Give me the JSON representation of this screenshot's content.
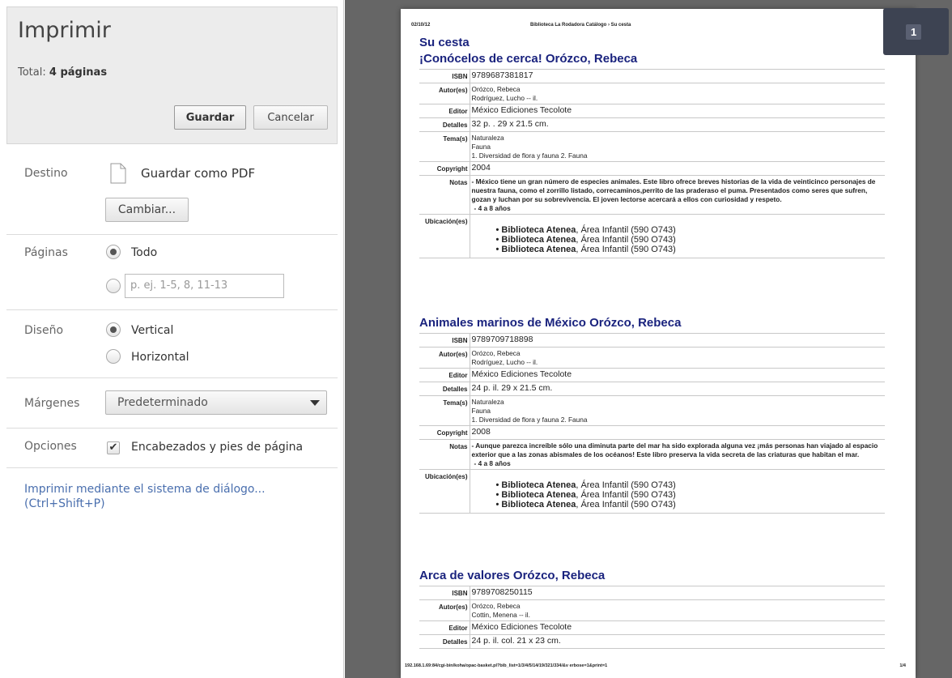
{
  "sidebar": {
    "title": "Imprimir",
    "total_label": "Total:",
    "total_value": "4 páginas",
    "save_label": "Guardar",
    "cancel_label": "Cancelar",
    "destination": {
      "label": "Destino",
      "value": "Guardar como PDF",
      "change_label": "Cambiar..."
    },
    "pages": {
      "label": "Páginas",
      "all_label": "Todo",
      "range_placeholder": "p. ej. 1-5, 8, 11-13"
    },
    "layout": {
      "label": "Diseño",
      "portrait_label": "Vertical",
      "landscape_label": "Horizontal"
    },
    "margins": {
      "label": "Márgenes",
      "value": "Predeterminado"
    },
    "options": {
      "label": "Opciones",
      "headers_label": "Encabezados y pies de página"
    },
    "system_dialog_link": "Imprimir mediante el sistema de diálogo...",
    "system_dialog_shortcut": "(Ctrl+Shift+P)"
  },
  "preview": {
    "page_indicator": "1",
    "header_date": "02/10/12",
    "header_title": "Biblioteca La Rodadora Catálogo › Su cesta",
    "heading": "Su cesta",
    "footer_url": "192.168.1.69:84/cgi-bin/koha/opac-basket.pl?bib_list=1/3/4/5/14/19/321/334/&v erbose=1&print=1",
    "footer_page": "1/4",
    "books": [
      {
        "title": "¡Conócelos de cerca! Orózco, Rebeca",
        "isbn_k": "ISBN",
        "isbn": "9789687381817",
        "autor_k": "Autor(es)",
        "autor1": "Orózco, Rebeca",
        "autor2": "Rodríguez, Lucho -- il.",
        "editor_k": "Editor",
        "editor": "México Ediciones Tecolote",
        "detalles_k": "Detalles",
        "detalles": "32 p. . 29 x 21.5 cm.",
        "tema_k": "Tema(s)",
        "tema1": "Naturaleza",
        "tema2": "Fauna",
        "tema3": "1. Diversidad de flora y fauna 2. Fauna",
        "copyright_k": "Copyright",
        "copyright": "2004",
        "notas_k": "Notas",
        "notas": "- México tiene un gran número de especies animales. Este libro ofrece breves historias de la vida de veinticinco personajes de nuestra fauna, como el zorrillo listado, correcaminos,perrito de las praderaso el puma. Presentados como seres que sufren, gozan y luchan por su sobrevivencia. El joven lectorse acercará a ellos con curiosidad y respeto.",
        "edad": "- 4 a 8 años",
        "ubic_k": "Ubicación(es)",
        "loc_name": "Biblioteca Atenea",
        "loc_rest": ", Área Infantil (590 O743)"
      },
      {
        "title": "Animales marinos de México Orózco, Rebeca",
        "isbn_k": "ISBN",
        "isbn": "9789709718898",
        "autor_k": "Autor(es)",
        "autor1": "Orózco, Rebeca",
        "autor2": "Rodríguez, Lucho -- il.",
        "editor_k": "Editor",
        "editor": "México Ediciones Tecolote",
        "detalles_k": "Detalles",
        "detalles": "24 p. il. 29 x 21.5 cm.",
        "tema_k": "Tema(s)",
        "tema1": "Naturaleza",
        "tema2": "Fauna",
        "tema3": "1. Diversidad de flora y fauna 2. Fauna",
        "copyright_k": "Copyright",
        "copyright": "2008",
        "notas_k": "Notas",
        "notas": "- Aunque parezca increíble sólo una diminuta parte del mar ha sido explorada alguna vez ¡más personas han viajado al espacio exterior que a las zonas abismales de los océanos! Este libro preserva la vida secreta de las criaturas que habitan el mar.",
        "edad": "- 4 a 8 años",
        "ubic_k": "Ubicación(es)",
        "loc_name": "Biblioteca Atenea",
        "loc_rest": ", Área Infantil (590 O743)"
      },
      {
        "title": "Arca de valores Orózco, Rebeca",
        "isbn_k": "ISBN",
        "isbn": "9789708250115",
        "autor_k": "Autor(es)",
        "autor1": "Orózco, Rebeca",
        "autor2": "Cottin, Menena -- il.",
        "editor_k": "Editor",
        "editor": "México Ediciones Tecolote",
        "detalles_k": "Detalles",
        "detalles": "24 p. il. col. 21 x 23 cm."
      }
    ]
  }
}
